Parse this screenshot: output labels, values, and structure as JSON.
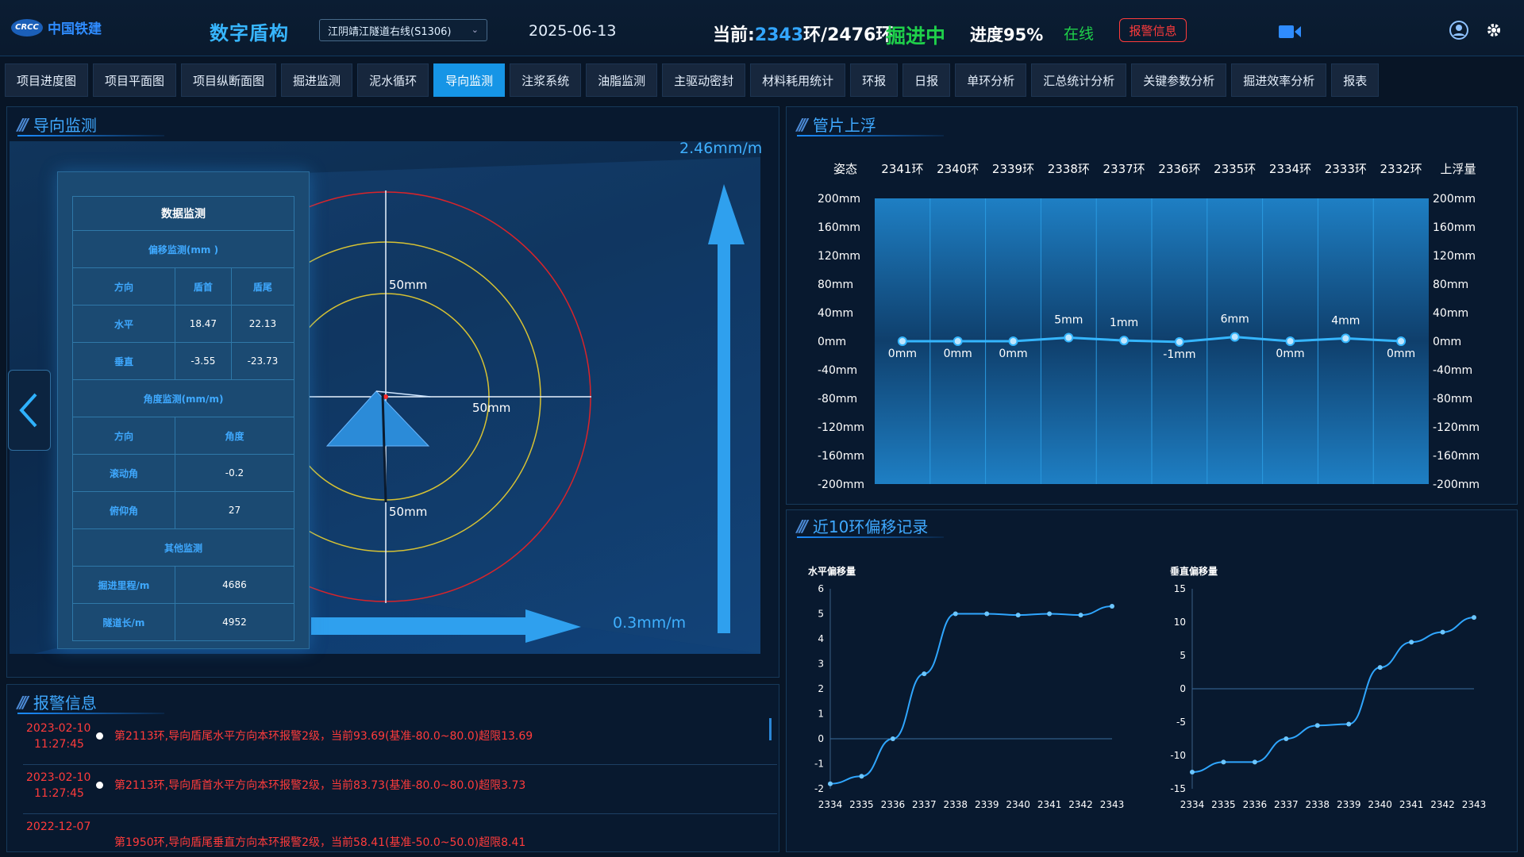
{
  "header": {
    "logo_text": "中国铁建",
    "logo_mark": "CRCC",
    "app_title": "数字盾构",
    "project": "江阴靖江隧道右线(S1306)",
    "date": "2025-06-13",
    "status_prefix": "当前:",
    "current_ring": "2343",
    "total_ring": "环/2476环",
    "excavating": "掘进中",
    "progress": "进度95%",
    "online": "在线",
    "alarm_button": "报警信息"
  },
  "tabs": [
    "项目进度图",
    "项目平面图",
    "项目纵断面图",
    "掘进监测",
    "泥水循环",
    "导向监测",
    "注浆系统",
    "油脂监测",
    "主驱动密封",
    "材料耗用统计",
    "环报",
    "日报",
    "单环分析",
    "汇总统计分析",
    "关键参数分析",
    "掘进效率分析",
    "报表"
  ],
  "active_tab": "导向监测",
  "guide": {
    "title": "导向监测",
    "vertical_rate": "2.46mm/m",
    "horizontal_rate": "0.3mm/m",
    "ring_labels": [
      "50mm",
      "50mm",
      "50mm"
    ],
    "table": {
      "title": "数据监测",
      "offset_section": "偏移监测(mm )",
      "col_dir": "方向",
      "col_head": "盾首",
      "col_tail": "盾尾",
      "rows": [
        {
          "dir": "水平",
          "head": "18.47",
          "tail": "22.13"
        },
        {
          "dir": "垂直",
          "head": "-3.55",
          "tail": "-23.73"
        }
      ],
      "angle_section": "角度监测(mm/m)",
      "angle_col_dir": "方向",
      "angle_col_val": "角度",
      "angle_rows": [
        {
          "dir": "滚动角",
          "val": "-0.2"
        },
        {
          "dir": "俯仰角",
          "val": "27"
        }
      ],
      "other_section": "其他监测",
      "other_rows": [
        {
          "name": "掘进里程/m",
          "val": "4686"
        },
        {
          "name": "隧道长/m",
          "val": "4952"
        }
      ]
    }
  },
  "float_panel": {
    "title": "管片上浮",
    "header_left": "姿态",
    "header_right": "上浮量",
    "y_ticks": [
      "200mm",
      "160mm",
      "120mm",
      "80mm",
      "40mm",
      "0mm",
      "-40mm",
      "-80mm",
      "-120mm",
      "-160mm",
      "-200mm"
    ]
  },
  "alarm_panel": {
    "title": "报警信息",
    "items": [
      {
        "date": "2023-02-10",
        "time": "11:27:45",
        "msg": "第2113环,导向盾尾水平方向本环报警2级，当前93.69(基准-80.0~80.0)超限13.69"
      },
      {
        "date": "2023-02-10",
        "time": "11:27:45",
        "msg": "第2113环,导向盾首水平方向本环报警2级，当前83.73(基准-80.0~80.0)超限3.73"
      },
      {
        "date": "2022-12-07",
        "time": "",
        "msg": "第1950环,导向盾尾垂直方向本环报警2级，当前58.41(基准-50.0~50.0)超限8.41"
      }
    ]
  },
  "offset_panel": {
    "title": "近10环偏移记录"
  },
  "chart_data": [
    {
      "type": "line",
      "title": "管片上浮",
      "categories": [
        "2341环",
        "2340环",
        "2339环",
        "2338环",
        "2337环",
        "2336环",
        "2335环",
        "2334环",
        "2333环",
        "2332环"
      ],
      "values": [
        0,
        0,
        0,
        5,
        1,
        -1,
        6,
        0,
        4,
        0
      ],
      "data_labels": [
        "0mm",
        "0mm",
        "0mm",
        "5mm",
        "1mm",
        "-1mm",
        "6mm",
        "0mm",
        "4mm",
        "0mm"
      ],
      "ylim": [
        -200,
        200
      ],
      "unit": "mm"
    },
    {
      "type": "line",
      "title": "水平偏移量",
      "x": [
        "2334",
        "2335",
        "2336",
        "2337",
        "2338",
        "2339",
        "2340",
        "2341",
        "2342",
        "2343"
      ],
      "values": [
        -1.8,
        -1.5,
        0.0,
        2.6,
        5.0,
        5.0,
        4.95,
        5.0,
        4.95,
        5.3
      ],
      "ylim": [
        -2,
        6
      ],
      "yticks": [
        -2,
        -1,
        0,
        1,
        2,
        3,
        4,
        5,
        6
      ]
    },
    {
      "type": "line",
      "title": "垂直偏移量",
      "x": [
        "2334",
        "2335",
        "2336",
        "2337",
        "2338",
        "2339",
        "2340",
        "2341",
        "2342",
        "2343"
      ],
      "values": [
        -12.5,
        -11,
        -11,
        -7.5,
        -5.5,
        -5.3,
        3.2,
        7.0,
        8.5,
        10.7
      ],
      "ylim": [
        -15,
        15
      ],
      "yticks": [
        -15,
        -10,
        -5,
        0,
        5,
        10,
        15
      ]
    }
  ]
}
